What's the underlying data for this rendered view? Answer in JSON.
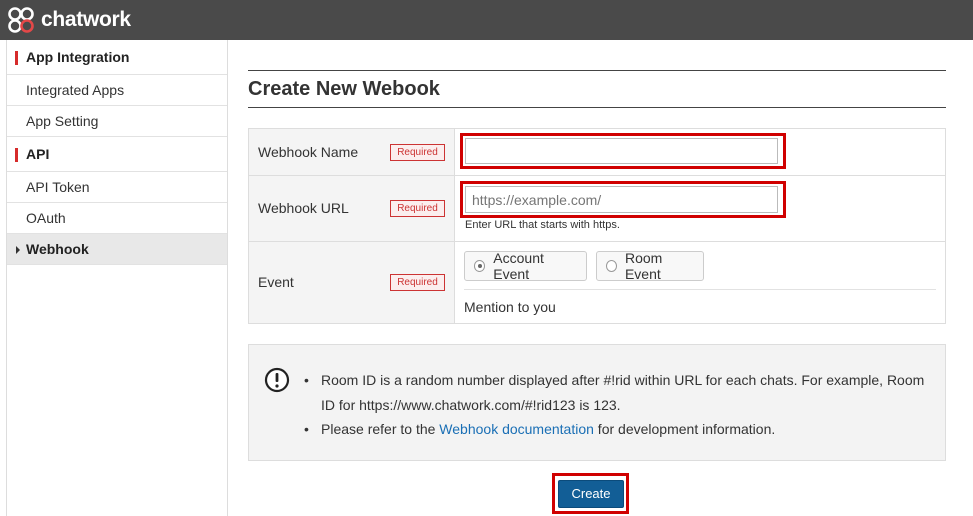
{
  "app": {
    "logo_text": "chatwork"
  },
  "sidebar": {
    "sections": [
      {
        "title": "App Integration",
        "items": [
          {
            "label": "Integrated Apps"
          },
          {
            "label": "App Setting"
          }
        ]
      },
      {
        "title": "API",
        "items": [
          {
            "label": "API Token"
          },
          {
            "label": "OAuth"
          },
          {
            "label": "Webhook",
            "active": true
          }
        ]
      }
    ]
  },
  "page": {
    "title": "Create New Webook"
  },
  "form": {
    "required_badge": "Required",
    "webhook_name": {
      "label": "Webhook Name",
      "value": "",
      "placeholder": ""
    },
    "webhook_url": {
      "label": "Webhook URL",
      "value": "",
      "placeholder": "https://example.com/",
      "hint": "Enter URL that starts with https."
    },
    "event": {
      "label": "Event",
      "options": [
        {
          "label": "Account Event",
          "selected": true
        },
        {
          "label": "Room Event",
          "selected": false
        }
      ],
      "sub_option": "Mention to you"
    }
  },
  "notice": {
    "icon": "exclamation-circle-icon",
    "line1": "Room ID is a random number displayed after #!rid within URL for each chats. For example, Room ID for https://www.chatwork.com/#!rid123 is 123.",
    "line2_prefix": "Please refer to the ",
    "line2_link": "Webhook documentation",
    "line2_suffix": " for development information."
  },
  "actions": {
    "create_label": "Create"
  },
  "colors": {
    "topbar": "#4a4a4a",
    "accent_red": "#d62b2b",
    "highlight": "#d00000",
    "primary_button": "#125e96",
    "link": "#1a6fb5"
  }
}
